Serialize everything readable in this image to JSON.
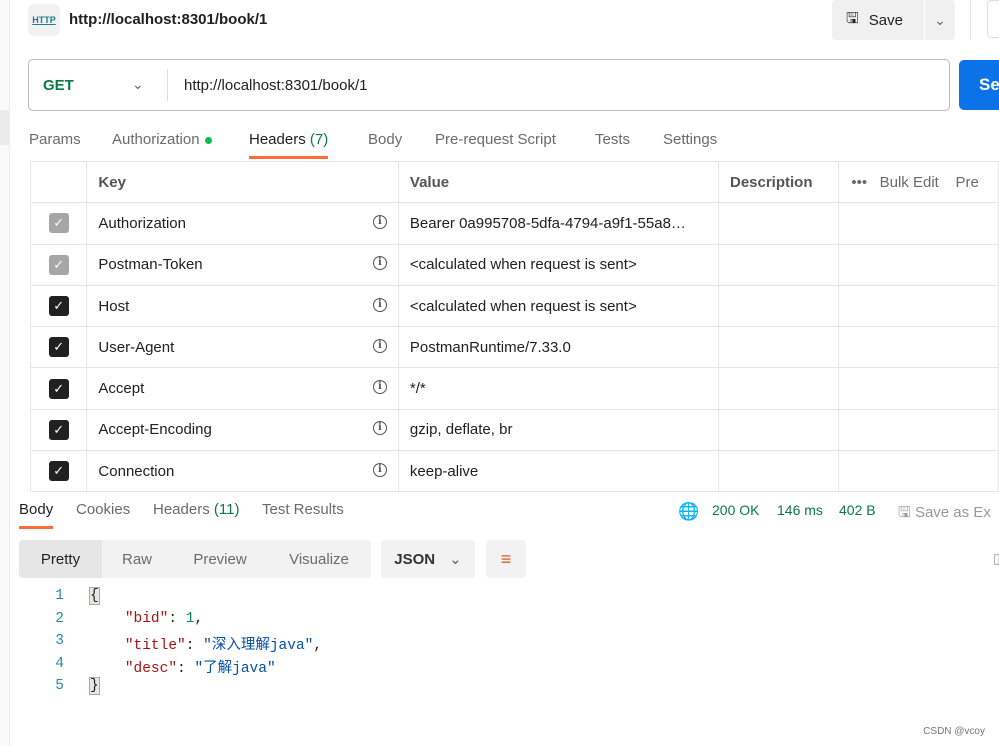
{
  "request": {
    "title": "http://localhost:8301/book/1",
    "method": "GET",
    "url": "http://localhost:8301/book/1",
    "save_label": "Save",
    "send_label": "Se"
  },
  "req_tabs": [
    {
      "label": "Params"
    },
    {
      "label": "Authorization"
    },
    {
      "label": "Headers",
      "count": "(7)"
    },
    {
      "label": "Body"
    },
    {
      "label": "Pre-request Script"
    },
    {
      "label": "Tests"
    },
    {
      "label": "Settings"
    }
  ],
  "headers_table": {
    "columns": [
      "Key",
      "Value",
      "Description"
    ],
    "bulk_edit": "Bulk Edit",
    "presets": "Pre",
    "rows": [
      {
        "key": "Authorization",
        "value": "Bearer 0a995708-5dfa-4794-a9f1-55a8…",
        "checked": true,
        "disabled": true
      },
      {
        "key": "Postman-Token",
        "value": "<calculated when request is sent>",
        "checked": true,
        "disabled": true
      },
      {
        "key": "Host",
        "value": "<calculated when request is sent>",
        "checked": true,
        "disabled": false
      },
      {
        "key": "User-Agent",
        "value": "PostmanRuntime/7.33.0",
        "checked": true,
        "disabled": false
      },
      {
        "key": "Accept",
        "value": "*/*",
        "checked": true,
        "disabled": false
      },
      {
        "key": "Accept-Encoding",
        "value": "gzip, deflate, br",
        "checked": true,
        "disabled": false
      },
      {
        "key": "Connection",
        "value": "keep-alive",
        "checked": true,
        "disabled": false
      }
    ]
  },
  "response": {
    "tabs": [
      {
        "label": "Body"
      },
      {
        "label": "Cookies"
      },
      {
        "label": "Headers",
        "count": "(11)"
      },
      {
        "label": "Test Results"
      }
    ],
    "status": "200 OK",
    "time": "146 ms",
    "size": "402 B",
    "save_as": "Save as Ex",
    "views": [
      "Pretty",
      "Raw",
      "Preview",
      "Visualize"
    ],
    "format": "JSON",
    "lines": [
      "1",
      "2",
      "3",
      "4",
      "5"
    ],
    "body": {
      "bid_key": "\"bid\"",
      "bid_val": "1",
      "title_key": "\"title\"",
      "title_val": "\"深入理解java\"",
      "desc_key": "\"desc\"",
      "desc_val": "\"了解java\""
    }
  },
  "watermark": "CSDN @vcoy",
  "colors": {
    "accent": "#ff6c37",
    "send": "#0b72e7",
    "success": "#0b7a45"
  }
}
